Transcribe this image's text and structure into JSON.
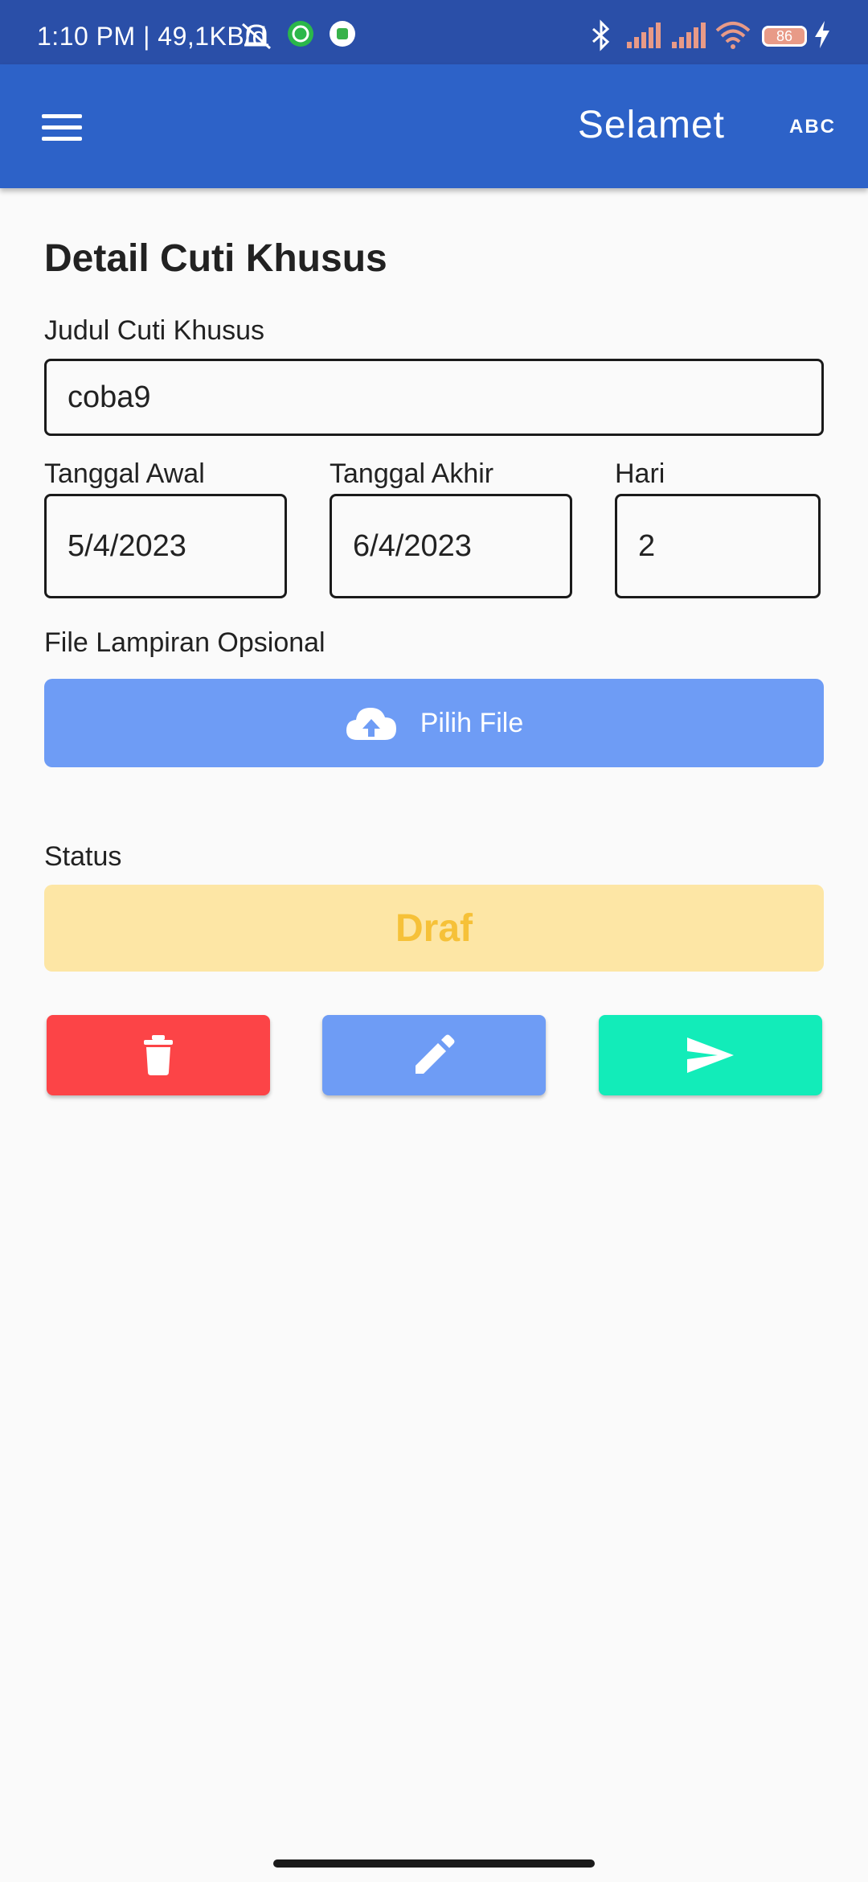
{
  "status_bar": {
    "time_speed": "1:10 PM | 49,1KB/d",
    "battery": "86",
    "icons": [
      "alarm-off-icon",
      "whatsapp-icon",
      "notification-app-icon",
      "bluetooth-icon",
      "signal-icon",
      "signal-icon",
      "wifi-icon",
      "battery-icon",
      "charging-icon"
    ]
  },
  "app_bar": {
    "user_name": "Selamet",
    "abc_label": "ABC"
  },
  "form": {
    "title": "Detail Cuti Khusus",
    "judul_label": "Judul Cuti Khusus",
    "judul_value": "coba9",
    "tanggal_awal_label": "Tanggal Awal",
    "tanggal_awal_value": "5/4/2023",
    "tanggal_akhir_label": "Tanggal Akhir",
    "tanggal_akhir_value": "6/4/2023",
    "hari_label": "Hari",
    "hari_value": "2",
    "file_label": "File Lampiran Opsional",
    "file_button": "Pilih File",
    "status_label": "Status",
    "status_value": "Draf"
  },
  "actions": {
    "colors": {
      "delete": "#fc4447",
      "edit": "#6e9cf5",
      "send": "#12ecb9"
    }
  }
}
